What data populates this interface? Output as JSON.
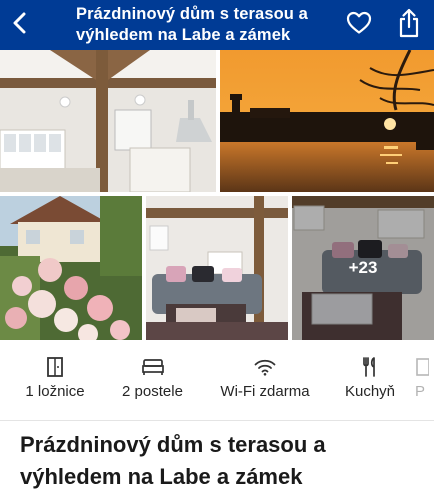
{
  "header": {
    "title": "Prázdninový dům s terasou a výhledem na Labe a zámek",
    "back_icon": "chevron-left-icon",
    "favorite_icon": "heart-icon",
    "share_icon": "share-icon",
    "background": "#003b95"
  },
  "gallery": {
    "more_count": "+23",
    "photos": [
      "interior-kitchen-beams",
      "river-sunset-castle",
      "house-garden-hydrangea",
      "living-room-sofa",
      "living-room-sofa-2"
    ]
  },
  "amenities": [
    {
      "label": "1 ložnice",
      "icon": "door-icon"
    },
    {
      "label": "2 postele",
      "icon": "bed-icon"
    },
    {
      "label": "Wi-Fi zdarma",
      "icon": "wifi-icon"
    },
    {
      "label": "Kuchyň",
      "icon": "fork-knife-icon"
    },
    {
      "label": "P",
      "icon": "partial-icon"
    }
  ],
  "property": {
    "title": "Prázdninový dům s terasou a výhledem na Labe a zámek"
  }
}
